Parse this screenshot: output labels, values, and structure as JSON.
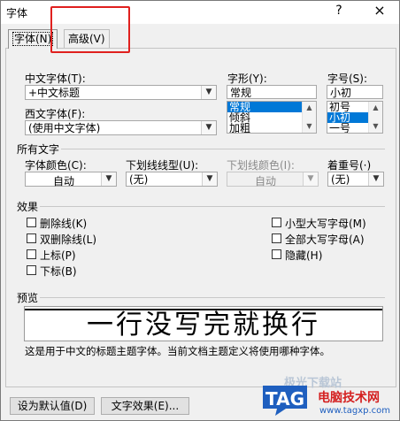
{
  "window": {
    "title": "字体",
    "help_glyph": "?",
    "close_glyph": "×"
  },
  "tabs": [
    {
      "label": "字体(N)",
      "active": true
    },
    {
      "label": "高级(V)",
      "active": false
    }
  ],
  "chinese_font": {
    "label": "中文字体(T):",
    "value": "+中文标题"
  },
  "western_font": {
    "label": "西文字体(F):",
    "value": "(使用中文字体)"
  },
  "style": {
    "label": "字形(Y):",
    "value": "常规",
    "options": [
      "常规",
      "倾斜",
      "加粗"
    ],
    "selected_index": 0
  },
  "size": {
    "label": "字号(S):",
    "value": "小初",
    "options": [
      "初号",
      "小初",
      "一号"
    ],
    "selected_index": 1
  },
  "all_text": {
    "heading": "所有文字",
    "font_color": {
      "label": "字体颜色(C):",
      "value": "自动"
    },
    "underline_type": {
      "label": "下划线线型(U):",
      "value": "(无)"
    },
    "underline_color": {
      "label": "下划线颜色(I):",
      "value": "自动"
    },
    "emphasis": {
      "label": "着重号(·)",
      "value": "(无)"
    }
  },
  "effects": {
    "heading": "效果",
    "left": [
      "删除线(K)",
      "双删除线(L)",
      "上标(P)",
      "下标(B)"
    ],
    "right": [
      "小型大写字母(M)",
      "全部大写字母(A)",
      "隐藏(H)"
    ]
  },
  "preview": {
    "heading": "预览",
    "sample": "一行没写完就换行",
    "description": "这是用于中文的标题主题字体。当前文档主题定义将使用哪种字体。"
  },
  "buttons": {
    "set_default": "设为默认值(D)",
    "text_effects": "文字效果(E)..."
  },
  "watermark": {
    "brand": "TAG",
    "line1": "电脑技术网",
    "line2": "www.tagxp.com",
    "faded": "极光下载站"
  },
  "colors": {
    "selection": "#0078d7",
    "highlight_box": "#e0201e",
    "watermark_blue": "#1f5fbf",
    "watermark_red": "#d42020"
  }
}
